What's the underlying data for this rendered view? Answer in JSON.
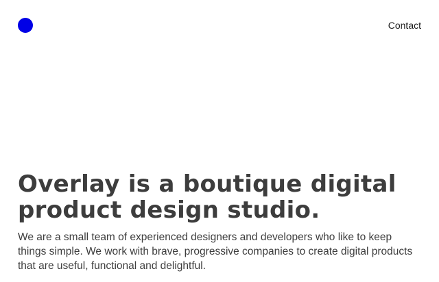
{
  "header": {
    "logo_icon": "circle-logo-icon",
    "logo_color": "#0000e6",
    "nav": {
      "contact_label": "Contact"
    }
  },
  "hero": {
    "title": "Overlay is a boutique digital product design studio.",
    "description": "We are a small team of experienced designers and developers who like to keep things simple. We work with brave, progressive companies to create digital products that are useful, functional and delightful."
  },
  "colors": {
    "text": "#3d3d3d",
    "background": "#ffffff",
    "accent": "#0000e6"
  }
}
